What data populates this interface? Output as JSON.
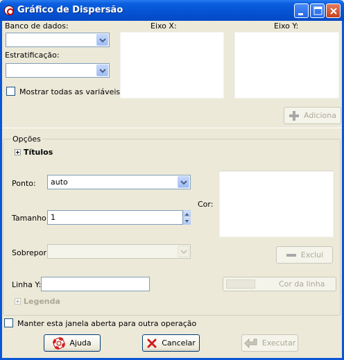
{
  "window": {
    "title": "Gráfico de Dispersão"
  },
  "labels": {
    "database": "Banco de dados:",
    "stratification": "Estratificação:",
    "show_all": "Mostrar todas as variáveis",
    "x_axis": "Eixo X:",
    "y_axis": "Eixo Y:"
  },
  "buttons": {
    "add": "Adiciona",
    "delete": "Exclui",
    "line_color": "Cor da linha",
    "help": "Ajuda",
    "cancel": "Cancelar",
    "execute": "Executar"
  },
  "options": {
    "group_title": "Opções",
    "titles": "Títulos",
    "point_label": "Ponto:",
    "point_value": "auto",
    "size_label": "Tamanho:",
    "size_value": "1",
    "overlay_label": "Sobrepor:",
    "color_label": "Cor:",
    "line_y_label": "Linha Y:",
    "line_y_value": "",
    "legend": "Legenda"
  },
  "keep_open": "Manter esta janela aberta para outra operação",
  "colors": {
    "title_bar": "#0552d2",
    "dialog_bg": "#ece9d8",
    "close_button": "#c7411e"
  },
  "icons": [
    "app-icon",
    "minimize-icon",
    "maximize-icon",
    "close-icon",
    "plus-icon",
    "minus-icon",
    "lifebuoy-icon",
    "cancel-x-icon",
    "execute-arrow-icon"
  ]
}
